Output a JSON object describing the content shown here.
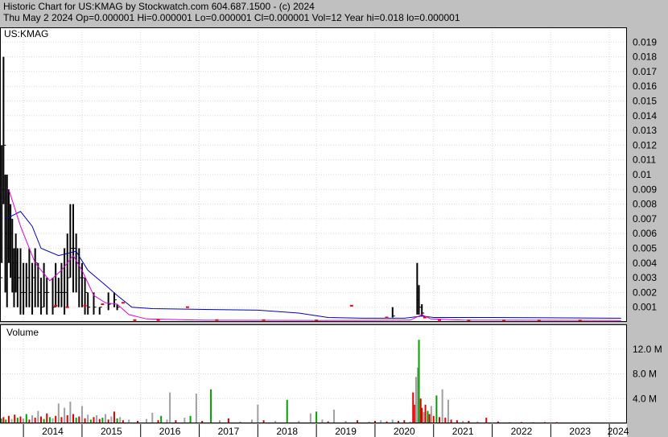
{
  "header": {
    "line1": "Historic Chart for US:KMAG by Stockwatch.com 604.687.1500 - (c) 2024",
    "line2": "Thu May  2 2024   Op=0.000001  Hi=0.000001  Lo=0.000001  Cl=0.000001  Vol=12   Year hi=0.018  lo=0.000001"
  },
  "chart_data": {
    "type": "line",
    "symbol": "US:KMAG",
    "price_axis": {
      "ylim": [
        0,
        0.02
      ],
      "ticks": [
        "0.019",
        "0.018",
        "0.017",
        "0.016",
        "0.015",
        "0.014",
        "0.013",
        "0.012",
        "0.011",
        "0.01",
        "0.009",
        "0.008",
        "0.007",
        "0.006",
        "0.005",
        "0.004",
        "0.003",
        "0.002",
        "0.001"
      ]
    },
    "volume_axis": {
      "label": "Volume",
      "ylim": [
        0,
        16000000
      ],
      "ticks": [
        "12.0 M",
        "8.0 M",
        "4.0 M"
      ]
    },
    "x_axis": {
      "range": [
        2013.6,
        2024.3
      ],
      "years": [
        "2014",
        "2015",
        "2016",
        "2017",
        "2018",
        "2019",
        "2020",
        "2021",
        "2022",
        "2023",
        "2024"
      ],
      "grid": true
    },
    "series": [
      {
        "style": "bar",
        "color": "#000000",
        "points": [
          [
            2013.6,
            0.005,
            0.001,
            0.003
          ],
          [
            2013.63,
            0.012,
            0.004,
            0.009
          ],
          [
            2013.66,
            0.018,
            0.008,
            0.012
          ],
          [
            2013.69,
            0.01,
            0.002,
            0.006
          ],
          [
            2013.72,
            0.01,
            0.001,
            0.005
          ],
          [
            2013.75,
            0.009,
            0.004,
            0.007
          ],
          [
            2013.78,
            0.008,
            0.003,
            0.006
          ],
          [
            2013.81,
            0.007,
            0.002,
            0.004
          ],
          [
            2013.84,
            0.005,
            0.001,
            0.003
          ],
          [
            2013.87,
            0.006,
            0.002,
            0.004
          ],
          [
            2013.9,
            0.005,
            0.001,
            0.003
          ],
          [
            2013.95,
            0.005,
            0.0005,
            0.002
          ],
          [
            2014.0,
            0.004,
            0.0005,
            0.002
          ],
          [
            2014.05,
            0.004,
            0.001,
            0.003
          ],
          [
            2014.1,
            0.005,
            0.001,
            0.002
          ],
          [
            2014.15,
            0.004,
            0.0005,
            0.003
          ],
          [
            2014.2,
            0.005,
            0.001,
            0.004
          ],
          [
            2014.25,
            0.004,
            0.001,
            0.002
          ],
          [
            2014.3,
            0.003,
            0.0005,
            0.001
          ],
          [
            2014.35,
            0.004,
            0.001,
            0.002
          ],
          [
            2014.4,
            0.003,
            0.0005,
            0.002
          ],
          [
            2014.5,
            0.003,
            0.0005,
            0.001
          ],
          [
            2014.55,
            0.004,
            0.001,
            0.002
          ],
          [
            2014.6,
            0.003,
            0.001,
            0.002
          ],
          [
            2014.65,
            0.004,
            0.001,
            0.002
          ],
          [
            2014.7,
            0.005,
            0.0005,
            0.002
          ],
          [
            2014.75,
            0.006,
            0.001,
            0.003
          ],
          [
            2014.8,
            0.008,
            0.003,
            0.005
          ],
          [
            2014.85,
            0.008,
            0.002,
            0.005
          ],
          [
            2014.9,
            0.006,
            0.002,
            0.004
          ],
          [
            2014.95,
            0.005,
            0.001,
            0.003
          ],
          [
            2015.0,
            0.004,
            0.001,
            0.003
          ],
          [
            2015.05,
            0.003,
            0.0005,
            0.002
          ],
          [
            2015.1,
            0.002,
            0.0005,
            0.001
          ],
          [
            2015.2,
            0.002,
            0.0005,
            0.001
          ],
          [
            2015.3,
            0.001,
            0.0005,
            0.001
          ],
          [
            2015.45,
            0.002,
            0.0008,
            0.0012
          ],
          [
            2015.55,
            0.002,
            0.001,
            0.0015
          ],
          [
            2015.6,
            0.0012,
            0.0008,
            0.001
          ],
          [
            2020.3,
            0.001,
            0.0003,
            0.0004
          ],
          [
            2020.72,
            0.004,
            0.0005,
            0.0015
          ],
          [
            2020.75,
            0.0025,
            0.0005,
            0.001
          ],
          [
            2020.8,
            0.0012,
            0.0004,
            0.0006
          ]
        ]
      },
      {
        "style": "line",
        "color": "#0000c0",
        "points": [
          [
            2013.7,
            0.007
          ],
          [
            2013.95,
            0.0075
          ],
          [
            2014.15,
            0.0065
          ],
          [
            2014.3,
            0.005
          ],
          [
            2014.6,
            0.0045
          ],
          [
            2014.9,
            0.0048
          ],
          [
            2015.1,
            0.0035
          ],
          [
            2015.4,
            0.0025
          ],
          [
            2015.6,
            0.0018
          ],
          [
            2015.85,
            0.001
          ],
          [
            2016.2,
            0.0009
          ],
          [
            2017.0,
            0.00085
          ],
          [
            2018.0,
            0.0008
          ],
          [
            2018.7,
            0.0006
          ],
          [
            2019.2,
            0.0003
          ],
          [
            2019.8,
            0.00025
          ],
          [
            2020.5,
            0.00025
          ],
          [
            2020.8,
            0.0004
          ],
          [
            2021.0,
            0.0003
          ],
          [
            2022.0,
            0.0003
          ],
          [
            2023.0,
            0.00028
          ],
          [
            2024.2,
            0.00025
          ]
        ]
      },
      {
        "style": "line",
        "color": "#e000e0",
        "points": [
          [
            2013.75,
            0.009
          ],
          [
            2013.95,
            0.0065
          ],
          [
            2014.2,
            0.004
          ],
          [
            2014.45,
            0.0028
          ],
          [
            2014.65,
            0.0035
          ],
          [
            2014.85,
            0.0045
          ],
          [
            2015.0,
            0.0035
          ],
          [
            2015.2,
            0.0018
          ],
          [
            2015.4,
            0.0013
          ],
          [
            2015.6,
            0.0012
          ],
          [
            2015.8,
            0.0005
          ],
          [
            2016.1,
            0.0002
          ],
          [
            2017.0,
            0.00012
          ],
          [
            2019.0,
            0.0001
          ],
          [
            2020.6,
            0.00012
          ],
          [
            2020.8,
            0.0005
          ],
          [
            2020.95,
            0.0002
          ],
          [
            2021.5,
            0.00012
          ],
          [
            2024.2,
            0.0001
          ]
        ]
      }
    ],
    "markers": {
      "color": "#ff0000",
      "points": [
        [
          2014.55,
          0.0011
        ],
        [
          2014.75,
          0.001
        ],
        [
          2015.05,
          0.0011
        ],
        [
          2015.35,
          0.0012
        ],
        [
          2015.7,
          0.0013
        ],
        [
          2015.9,
          0.00012
        ],
        [
          2016.3,
          0.00012
        ],
        [
          2016.8,
          0.001
        ],
        [
          2017.3,
          0.00012
        ],
        [
          2018.1,
          0.00012
        ],
        [
          2019.0,
          0.0001
        ],
        [
          2019.6,
          0.0011
        ],
        [
          2020.2,
          0.0003
        ],
        [
          2020.85,
          0.0003
        ],
        [
          2021.1,
          0.00012
        ],
        [
          2021.6,
          0.0001
        ],
        [
          2022.2,
          0.0001
        ],
        [
          2022.8,
          0.0001
        ],
        [
          2023.5,
          0.0001
        ]
      ]
    },
    "volume": {
      "colors": {
        "up": "#00a000",
        "down": "#e00000",
        "unchanged": "#a0a0a0"
      },
      "bars": [
        [
          2013.62,
          0.8,
          "up"
        ],
        [
          2013.66,
          1.0,
          "down"
        ],
        [
          2013.7,
          0.6,
          "up"
        ],
        [
          2013.75,
          1.2,
          "down"
        ],
        [
          2013.8,
          0.7,
          "unchanged"
        ],
        [
          2013.85,
          1.4,
          "down"
        ],
        [
          2013.9,
          0.9,
          "up"
        ],
        [
          2013.95,
          1.1,
          "down"
        ],
        [
          2014.0,
          0.8,
          "unchanged"
        ],
        [
          2014.05,
          1.5,
          "up"
        ],
        [
          2014.1,
          0.6,
          "down"
        ],
        [
          2014.15,
          1.3,
          "unchanged"
        ],
        [
          2014.2,
          0.9,
          "down"
        ],
        [
          2014.25,
          2.0,
          "unchanged"
        ],
        [
          2014.3,
          1.1,
          "down"
        ],
        [
          2014.35,
          0.7,
          "up"
        ],
        [
          2014.4,
          1.6,
          "down"
        ],
        [
          2014.45,
          1.0,
          "up"
        ],
        [
          2014.5,
          0.8,
          "unchanged"
        ],
        [
          2014.55,
          1.2,
          "down"
        ],
        [
          2014.6,
          3.2,
          "unchanged"
        ],
        [
          2014.65,
          1.0,
          "down"
        ],
        [
          2014.7,
          2.5,
          "unchanged"
        ],
        [
          2014.75,
          1.3,
          "down"
        ],
        [
          2014.8,
          3.5,
          "unchanged"
        ],
        [
          2014.85,
          1.5,
          "down"
        ],
        [
          2014.9,
          0.9,
          "up"
        ],
        [
          2014.95,
          1.1,
          "down"
        ],
        [
          2015.0,
          2.8,
          "unchanged"
        ],
        [
          2015.05,
          0.8,
          "down"
        ],
        [
          2015.1,
          1.4,
          "unchanged"
        ],
        [
          2015.15,
          0.6,
          "up"
        ],
        [
          2015.2,
          1.0,
          "down"
        ],
        [
          2015.25,
          1.3,
          "unchanged"
        ],
        [
          2015.3,
          0.7,
          "down"
        ],
        [
          2015.35,
          0.9,
          "up"
        ],
        [
          2015.4,
          1.5,
          "unchanged"
        ],
        [
          2015.45,
          0.6,
          "down"
        ],
        [
          2015.5,
          1.1,
          "unchanged"
        ],
        [
          2015.55,
          1.9,
          "down"
        ],
        [
          2015.6,
          0.8,
          "up"
        ],
        [
          2015.65,
          1.0,
          "unchanged"
        ],
        [
          2015.7,
          0.5,
          "down"
        ],
        [
          2015.8,
          0.6,
          "unchanged"
        ],
        [
          2015.95,
          0.4,
          "down"
        ],
        [
          2016.1,
          0.7,
          "unchanged"
        ],
        [
          2016.2,
          1.7,
          "unchanged"
        ],
        [
          2016.3,
          0.5,
          "down"
        ],
        [
          2016.35,
          1.2,
          "up"
        ],
        [
          2016.45,
          0.6,
          "unchanged"
        ],
        [
          2016.5,
          5.0,
          "unchanged"
        ],
        [
          2016.6,
          0.5,
          "down"
        ],
        [
          2016.75,
          0.9,
          "unchanged"
        ],
        [
          2016.85,
          1.2,
          "up"
        ],
        [
          2016.95,
          4.8,
          "unchanged"
        ],
        [
          2017.05,
          0.4,
          "down"
        ],
        [
          2017.2,
          5.5,
          "up"
        ],
        [
          2017.35,
          0.5,
          "unchanged"
        ],
        [
          2017.5,
          0.8,
          "down"
        ],
        [
          2017.7,
          0.3,
          "unchanged"
        ],
        [
          2017.9,
          0.6,
          "unchanged"
        ],
        [
          2018.0,
          3.0,
          "unchanged"
        ],
        [
          2018.1,
          0.5,
          "down"
        ],
        [
          2018.3,
          0.4,
          "unchanged"
        ],
        [
          2018.5,
          3.8,
          "up"
        ],
        [
          2018.7,
          0.4,
          "unchanged"
        ],
        [
          2018.9,
          1.6,
          "unchanged"
        ],
        [
          2019.0,
          1.9,
          "up"
        ],
        [
          2019.1,
          0.6,
          "unchanged"
        ],
        [
          2019.2,
          0.3,
          "down"
        ],
        [
          2019.3,
          2.2,
          "unchanged"
        ],
        [
          2019.5,
          0.4,
          "unchanged"
        ],
        [
          2019.7,
          0.5,
          "down"
        ],
        [
          2019.9,
          0.3,
          "unchanged"
        ],
        [
          2020.0,
          0.4,
          "down"
        ],
        [
          2020.1,
          0.5,
          "unchanged"
        ],
        [
          2020.2,
          0.3,
          "down"
        ],
        [
          2020.3,
          0.6,
          "unchanged"
        ],
        [
          2020.4,
          0.4,
          "down"
        ],
        [
          2020.5,
          0.5,
          "down"
        ],
        [
          2020.6,
          0.3,
          "unchanged"
        ],
        [
          2020.65,
          5.0,
          "down"
        ],
        [
          2020.68,
          3.0,
          "down"
        ],
        [
          2020.7,
          7.5,
          "unchanged"
        ],
        [
          2020.73,
          9.0,
          "unchanged"
        ],
        [
          2020.75,
          13.5,
          "up"
        ],
        [
          2020.78,
          4.0,
          "down"
        ],
        [
          2020.8,
          2.5,
          "down"
        ],
        [
          2020.83,
          1.8,
          "unchanged"
        ],
        [
          2020.86,
          3.0,
          "down"
        ],
        [
          2020.9,
          2.0,
          "up"
        ],
        [
          2020.93,
          1.5,
          "down"
        ],
        [
          2020.96,
          2.8,
          "unchanged"
        ],
        [
          2021.0,
          1.2,
          "down"
        ],
        [
          2021.05,
          4.5,
          "up"
        ],
        [
          2021.1,
          1.0,
          "down"
        ],
        [
          2021.15,
          5.5,
          "unchanged"
        ],
        [
          2021.2,
          0.9,
          "down"
        ],
        [
          2021.25,
          3.8,
          "unchanged"
        ],
        [
          2021.3,
          0.6,
          "down"
        ],
        [
          2021.4,
          0.5,
          "down"
        ],
        [
          2021.5,
          0.4,
          "unchanged"
        ],
        [
          2021.6,
          0.4,
          "down"
        ],
        [
          2021.75,
          0.3,
          "unchanged"
        ],
        [
          2021.9,
          0.9,
          "down"
        ],
        [
          2022.1,
          0.3,
          "down"
        ],
        [
          2022.3,
          0.2,
          "unchanged"
        ],
        [
          2022.5,
          0.2,
          "down"
        ],
        [
          2022.7,
          0.2,
          "unchanged"
        ],
        [
          2022.9,
          0.2,
          "down"
        ],
        [
          2023.1,
          0.2,
          "down"
        ],
        [
          2023.4,
          0.15,
          "unchanged"
        ],
        [
          2023.7,
          0.15,
          "down"
        ],
        [
          2024.0,
          0.1,
          "down"
        ]
      ]
    }
  }
}
